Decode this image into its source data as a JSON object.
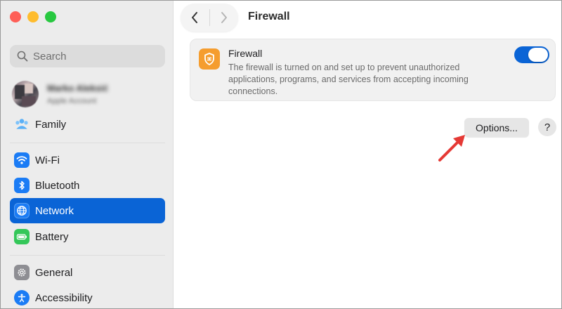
{
  "window": {
    "title": "Firewall"
  },
  "sidebar": {
    "search_placeholder": "Search",
    "account": {
      "name": "Marko Aleksić",
      "subtitle": "Apple Account"
    },
    "family_label": "Family",
    "items": [
      {
        "label": "Wi-Fi",
        "icon": "wifi-icon",
        "color": "#1b7cf5"
      },
      {
        "label": "Bluetooth",
        "icon": "bluetooth-icon",
        "color": "#1b7cf5"
      },
      {
        "label": "Network",
        "icon": "globe-icon",
        "color": "#1b7cf5",
        "selected": true
      },
      {
        "label": "Battery",
        "icon": "battery-icon",
        "color": "#34c759"
      },
      {
        "label": "General",
        "icon": "gear-icon",
        "color": "#8e8e93"
      },
      {
        "label": "Accessibility",
        "icon": "accessibility-icon",
        "color": "#1b7cf5"
      }
    ]
  },
  "firewall": {
    "title": "Firewall",
    "description": "The firewall is turned on and set up to prevent unauthorized applications, programs, and services from accepting incoming connections.",
    "enabled": true
  },
  "buttons": {
    "options_label": "Options...",
    "help_label": "?"
  },
  "colors": {
    "accent": "#0a64d6",
    "firewall_icon": "#f59d2f",
    "annotation_arrow": "#e53935"
  }
}
